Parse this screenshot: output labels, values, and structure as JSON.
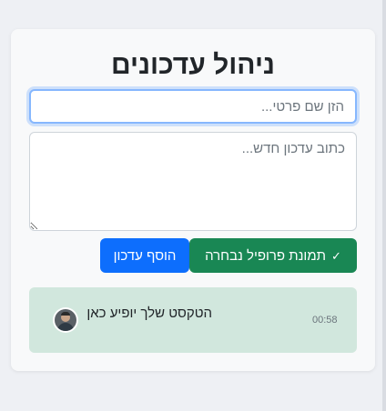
{
  "app": {
    "title": "ניהול עדכונים"
  },
  "form": {
    "name_placeholder": "הזן שם פרטי...",
    "update_placeholder": "כתוב עדכון חדש...",
    "profile_button_label": "תמונת פרופיל נבחרה",
    "profile_button_icon": "check-icon",
    "add_button_label": "הוסף עדכון"
  },
  "updates": [
    {
      "text": "הטקסט שלך יופיע כאן",
      "time": "00:58",
      "avatar_icon": "avatar"
    }
  ],
  "colors": {
    "primary": "#0d6efd",
    "success": "#198754",
    "update_bg": "#d1e7dd",
    "focus_border": "#86b7fe"
  }
}
